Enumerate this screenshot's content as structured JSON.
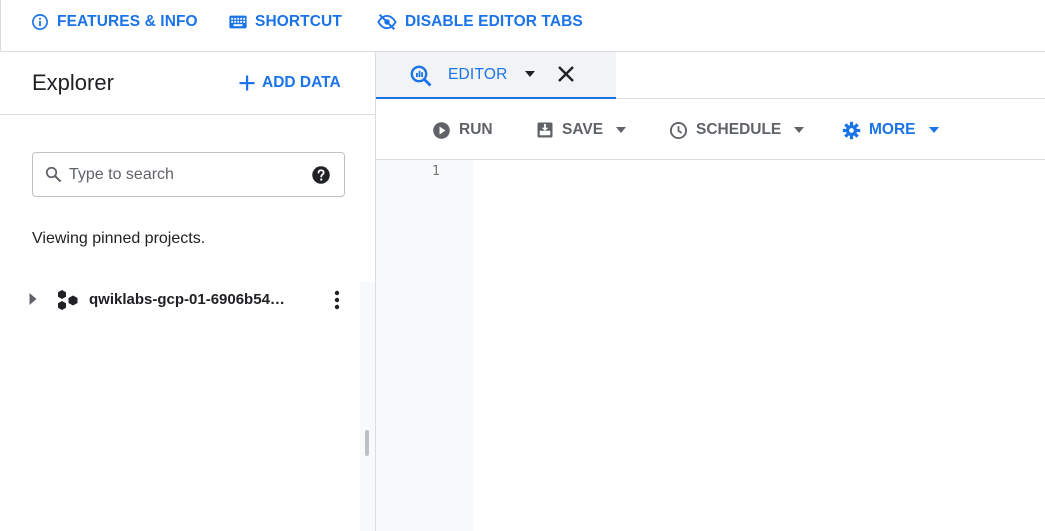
{
  "topbar": {
    "features_label": "FEATURES & INFO",
    "shortcut_label": "SHORTCUT",
    "disable_tabs_label": "DISABLE EDITOR TABS"
  },
  "explorer": {
    "title": "Explorer",
    "add_data_label": "ADD DATA",
    "search": {
      "placeholder": "Type to search",
      "value": ""
    },
    "pinned_text": "Viewing pinned projects.",
    "projects": [
      {
        "name": "qwiklabs-gcp-01-6906b54…"
      }
    ]
  },
  "tabs": [
    {
      "label": "EDITOR",
      "active": true
    }
  ],
  "toolbar": {
    "run_label": "RUN",
    "save_label": "SAVE",
    "schedule_label": "SCHEDULE",
    "more_label": "MORE"
  },
  "editor": {
    "line_numbers": [
      "1"
    ],
    "content": ""
  },
  "colors": {
    "accent": "#1a73e8",
    "muted": "#5f6368",
    "border": "#dadce0",
    "gutter": "#f8f9fa"
  },
  "icons": {
    "features": "info-icon",
    "shortcut": "keyboard-icon",
    "disable_tabs": "eye-off-icon",
    "add_data": "plus-icon",
    "search": "search-icon",
    "help": "help-icon",
    "project": "project-hexagons-icon",
    "menu": "more-vert-icon",
    "editor_tab": "query-magnifier-icon",
    "run": "play-circle-icon",
    "save": "save-icon",
    "schedule": "clock-icon",
    "more": "gear-icon"
  }
}
